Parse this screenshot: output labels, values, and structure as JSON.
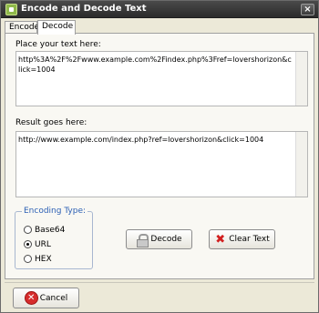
{
  "window": {
    "title": "Encode and Decode Text",
    "close_glyph": "×"
  },
  "tabs": [
    {
      "label": "Encode",
      "active": false
    },
    {
      "label": "Decode",
      "active": true
    }
  ],
  "decode": {
    "input_label": "Place your text here:",
    "input_value": "http%3A%2F%2Fwww.example.com%2Findex.php%3Fref=lovershorizon&click=1004",
    "output_label": "Result goes here:",
    "output_value": "http://www.example.com/index.php?ref=lovershorizon&click=1004"
  },
  "encoding": {
    "group_title": "Encoding Type:",
    "options": [
      {
        "label": "Base64",
        "checked": false
      },
      {
        "label": "URL",
        "checked": true
      },
      {
        "label": "HEX",
        "checked": false
      }
    ]
  },
  "buttons": {
    "decode": "Decode",
    "clear": "Clear Text",
    "cancel": "Cancel"
  },
  "colors": {
    "titlebar": "#2b2b2b",
    "group_title": "#2b5fb4",
    "cancel_icon": "#d62c2c",
    "clear_icon": "#d21f1f"
  },
  "icons": {
    "app": "app-icon",
    "decode": "lock-icon",
    "clear": "x-icon",
    "cancel": "x-circle-icon"
  }
}
